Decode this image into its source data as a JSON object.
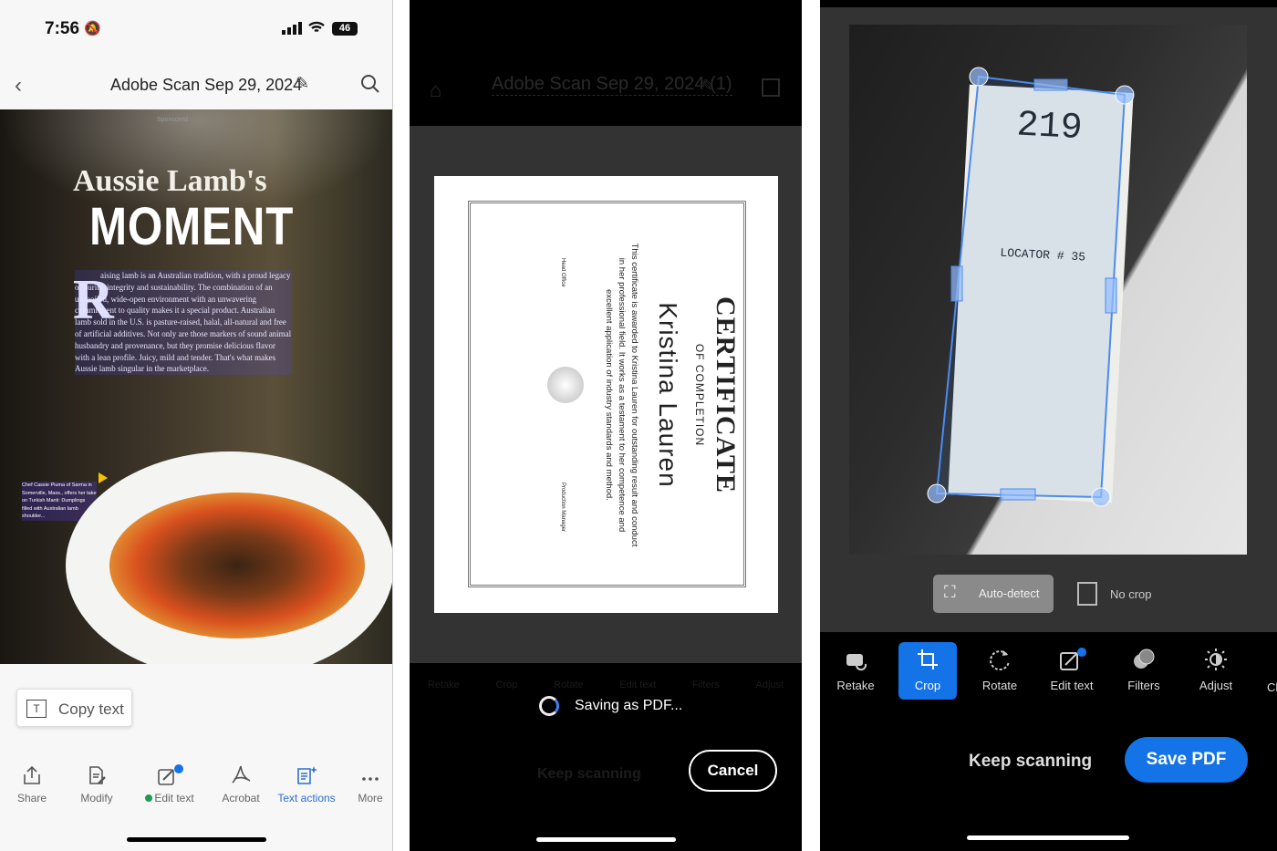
{
  "panel1": {
    "status": {
      "time": "7:56",
      "battery": "46"
    },
    "header": {
      "title": "Adobe Scan Sep 29, 2024"
    },
    "magazine": {
      "sponsored": "Sponsored",
      "headline1": "Aussie Lamb's",
      "headline2": "MOMENT",
      "dropcap": "R",
      "body": "aising lamb is an Australian tradition, with a proud legacy of purity, integrity and sustainability. The combination of an unspoiled, wide-open environment with an unwavering commitment to quality makes it a special product. Australian lamb sold in the U.S. is pasture-raised, halal, all-natural and free of artificial additives. Not only are those markers of sound animal husbandry and provenance, but they promise delicious flavor with a lean profile. Juicy, mild and tender. That's what makes Aussie lamb singular in the marketplace.",
      "caption": "Chef Cassie Piuma of Sarma in Somerville, Mass., offers her take on Turkish Manti: Dumplings filled with Australian lamb shoulder..."
    },
    "copy_text": "Copy text",
    "toolbar": [
      {
        "label": "Share",
        "icon": "share-icon"
      },
      {
        "label": "Modify",
        "icon": "modify-icon"
      },
      {
        "label": "Edit text",
        "icon": "edit-text-icon"
      },
      {
        "label": "Acrobat",
        "icon": "acrobat-icon"
      },
      {
        "label": "Text actions",
        "icon": "text-actions-icon"
      },
      {
        "label": "More",
        "icon": "more-icon"
      }
    ],
    "accent": "#2d6fd2"
  },
  "panel2": {
    "header": {
      "title": "Adobe Scan Sep 29, 2024 (1)"
    },
    "certificate": {
      "title": "CERTIFICATE",
      "subtitle": "OF COMPLETION",
      "name": "Kristina Lauren",
      "body": "This certificate is awarded to Kristina Lauren for outstanding result and conduct in her professional field. It works as a testament to her competence and excellent application of industry standards and method.",
      "sig1": "Head Office",
      "sig2": "Production Manager"
    },
    "saving": "Saving as PDF...",
    "cancel": "Cancel",
    "keep_scanning": "Keep scanning",
    "toolbar": [
      "Retake",
      "Crop",
      "Rotate",
      "Edit text",
      "Filters",
      "Adjust"
    ]
  },
  "panel3": {
    "receipt": {
      "number": "219",
      "locator": "LOCATOR # 35"
    },
    "auto_detect": "Auto-detect",
    "no_crop": "No crop",
    "toolbar": [
      {
        "label": "Retake",
        "icon": "retake-icon"
      },
      {
        "label": "Crop",
        "icon": "crop-icon",
        "active": true
      },
      {
        "label": "Rotate",
        "icon": "rotate-icon"
      },
      {
        "label": "Edit text",
        "icon": "edit-text-icon"
      },
      {
        "label": "Filters",
        "icon": "filters-icon"
      },
      {
        "label": "Adjust",
        "icon": "adjust-icon"
      },
      {
        "label": "Cl",
        "icon": ""
      }
    ],
    "keep_scanning": "Keep scanning",
    "save_pdf": "Save PDF",
    "accent": "#1473e6"
  }
}
